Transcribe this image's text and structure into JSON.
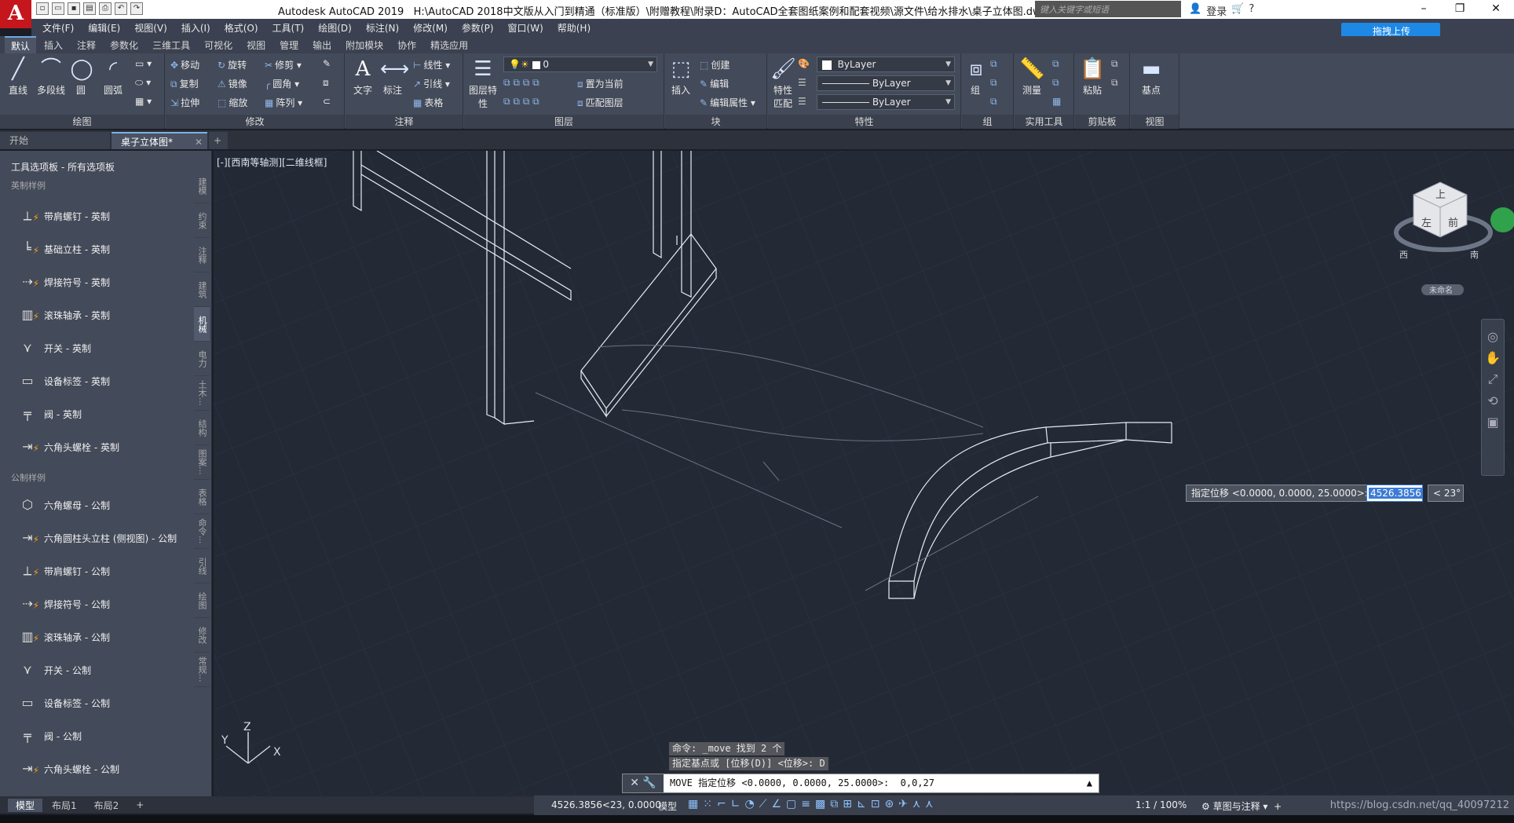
{
  "titlebar": {
    "app": "Autodesk AutoCAD 2019",
    "path": "H:\\AutoCAD 2018中文版从入门到精通（标准版）\\附赠教程\\附录D：AutoCAD全套图纸案例和配套视频\\源文件\\给水排水\\桌子立体图.dwg",
    "search_placeholder": "键入关键字或短语",
    "login": "登录"
  },
  "menu": [
    "文件(F)",
    "编辑(E)",
    "视图(V)",
    "插入(I)",
    "格式(O)",
    "工具(T)",
    "绘图(D)",
    "标注(N)",
    "修改(M)",
    "参数(P)",
    "窗口(W)",
    "帮助(H)"
  ],
  "share_button": "拖拽上传",
  "ribbon_tabs": [
    "默认",
    "插入",
    "注释",
    "参数化",
    "三维工具",
    "可视化",
    "视图",
    "管理",
    "输出",
    "附加模块",
    "协作",
    "精选应用"
  ],
  "panels": {
    "draw": {
      "title": "绘图",
      "items": [
        "直线",
        "多段线",
        "圆",
        "圆弧"
      ]
    },
    "modify": {
      "title": "修改",
      "items": [
        "移动",
        "旋转",
        "修剪",
        "复制",
        "镜像",
        "圆角",
        "拉伸",
        "缩放",
        "阵列"
      ]
    },
    "annotation": {
      "title": "注释",
      "items": [
        "文字",
        "标注",
        "线性",
        "引线",
        "表格"
      ]
    },
    "layers": {
      "title": "图层",
      "layer_name": "0",
      "items": [
        "图层特性",
        "置为当前",
        "匹配图层"
      ]
    },
    "block": {
      "title": "块",
      "items": [
        "插入",
        "创建",
        "编辑",
        "编辑属性"
      ]
    },
    "properties": {
      "title": "特性",
      "color": "ByLayer",
      "linetype": "ByLayer",
      "lineweight": "ByLayer",
      "match": "特性匹配"
    },
    "groups": {
      "title": "组",
      "item": "组"
    },
    "utilities": {
      "title": "实用工具",
      "item": "测量"
    },
    "clipboard": {
      "title": "剪贴板",
      "item": "粘贴"
    },
    "view": {
      "title": "视图",
      "item": "基点"
    }
  },
  "doc_tabs": [
    "开始",
    "桌子立体图*"
  ],
  "palette": {
    "title": "工具选项板 - 所有选项板",
    "group_imperial": "英制样例",
    "group_metric": "公制样例",
    "imperial": [
      "带肩螺钉 - 英制",
      "基础立柱 - 英制",
      "焊接符号 - 英制",
      "滚珠轴承 - 英制",
      "开关 - 英制",
      "设备标签 - 英制",
      "阀 - 英制",
      "六角头螺栓 - 英制"
    ],
    "metric": [
      "六角螺母 - 公制",
      "六角圆柱头立柱 (侧视图) - 公制",
      "带肩螺钉 - 公制",
      "焊接符号 - 公制",
      "滚珠轴承 - 公制",
      "开关 - 公制",
      "设备标签 - 公制",
      "阀 - 公制",
      "六角头螺栓 - 公制"
    ],
    "vtabs": [
      "建模",
      "约束",
      "注释",
      "建筑",
      "机械",
      "电力",
      "土木...",
      "结构",
      "图案...",
      "表格",
      "命令...",
      "引线",
      "绘图",
      "修改",
      "常规..."
    ]
  },
  "viewport": {
    "label": "[-][西南等轴测][二维线框]",
    "viewcube": {
      "top": "上",
      "front": "前",
      "left": "左",
      "south": "南",
      "west": "西",
      "unnamed": "未命名"
    }
  },
  "dynamic_input": {
    "prompt": "指定位移 <0.0000, 0.0000, 25.0000>:",
    "value": "4526.3856",
    "angle": "< 23°"
  },
  "command": {
    "history1": "命令: _move 找到 2 个",
    "history2": "指定基点或 [位移(D)] <位移>: D",
    "current": "MOVE 指定位移 <0.0000, 0.0000, 25.0000>:  0,0,27"
  },
  "layout_tabs": [
    "模型",
    "布局1",
    "布局2"
  ],
  "status": {
    "coords": "4526.3856<23, 0.0000",
    "model": "模型",
    "scale": "1:1 / 100%",
    "workspace": "草图与注释",
    "watermark": "https://blog.csdn.net/qq_40097212"
  },
  "ucs": {
    "x": "X",
    "y": "Y",
    "z": "Z"
  }
}
